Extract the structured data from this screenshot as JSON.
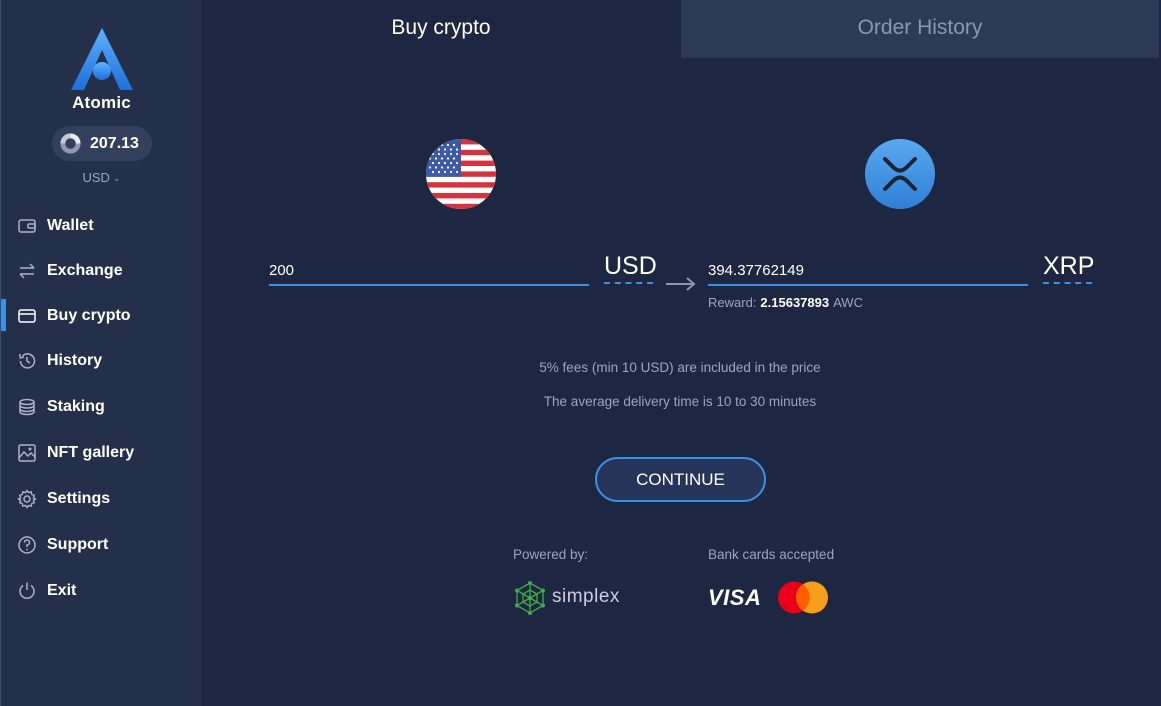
{
  "app": {
    "brand": "Atomic"
  },
  "balance": {
    "value": "207.13",
    "currency": "USD"
  },
  "sidebar": {
    "items": [
      {
        "label": "Wallet",
        "icon": "wallet-icon"
      },
      {
        "label": "Exchange",
        "icon": "exchange-icon"
      },
      {
        "label": "Buy crypto",
        "icon": "card-icon",
        "active": true
      },
      {
        "label": "History",
        "icon": "history-icon"
      },
      {
        "label": "Staking",
        "icon": "staking-icon"
      },
      {
        "label": "NFT gallery",
        "icon": "image-icon"
      },
      {
        "label": "Settings",
        "icon": "gear-icon"
      },
      {
        "label": "Support",
        "icon": "help-icon"
      },
      {
        "label": "Exit",
        "icon": "power-icon"
      }
    ]
  },
  "tabs": [
    {
      "label": "Buy crypto",
      "active": true
    },
    {
      "label": "Order History",
      "active": false
    }
  ],
  "exchange": {
    "from_amount": "200",
    "from_currency": "USD",
    "to_amount": "394.37762149",
    "to_currency": "XRP",
    "reward_label": "Reward:",
    "reward_value": "2.15637893",
    "reward_unit": "AWC"
  },
  "info": {
    "fees": "5% fees (min 10 USD) are included in the price",
    "delivery": "The average delivery time is 10 to 30 minutes"
  },
  "continue_label": "CONTINUE",
  "footer": {
    "powered_by": "Powered by:",
    "provider": "simplex",
    "cards_label": "Bank cards accepted",
    "visa": "VISA"
  },
  "colors": {
    "accent": "#3d8fe6",
    "background": "#1d2741",
    "sidebar": "#243049",
    "muted_text": "#9aa6bd"
  }
}
